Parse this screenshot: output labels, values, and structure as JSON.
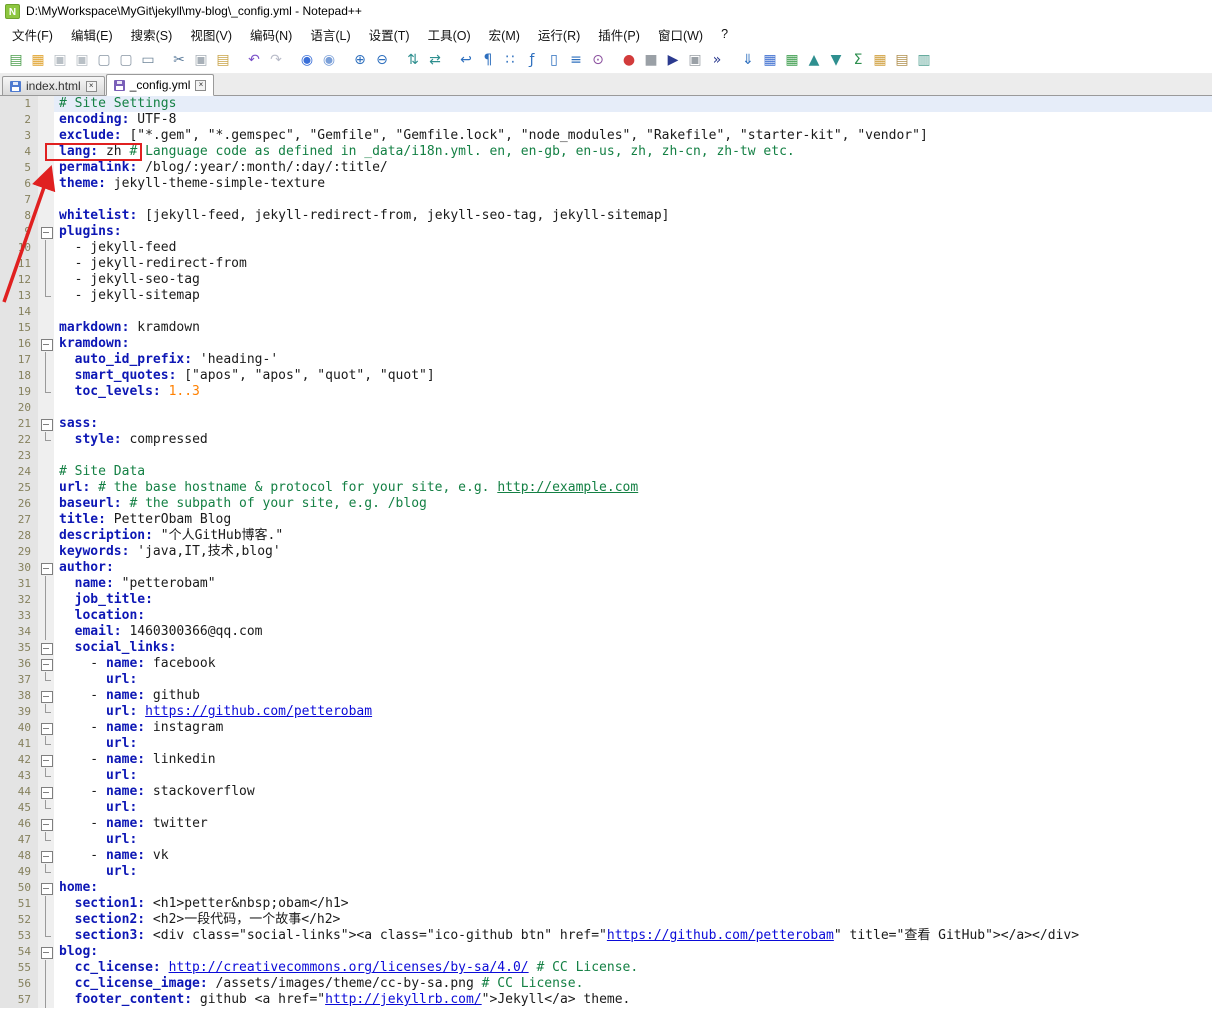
{
  "window": {
    "title": "D:\\MyWorkspace\\MyGit\\jekyll\\my-blog\\_config.yml - Notepad++"
  },
  "menu": {
    "items": [
      {
        "id": "file",
        "label": "文件(F)"
      },
      {
        "id": "edit",
        "label": "编辑(E)"
      },
      {
        "id": "search",
        "label": "搜索(S)"
      },
      {
        "id": "view",
        "label": "视图(V)"
      },
      {
        "id": "encoding",
        "label": "编码(N)"
      },
      {
        "id": "language",
        "label": "语言(L)"
      },
      {
        "id": "settings",
        "label": "设置(T)"
      },
      {
        "id": "tools",
        "label": "工具(O)"
      },
      {
        "id": "macro",
        "label": "宏(M)"
      },
      {
        "id": "run",
        "label": "运行(R)"
      },
      {
        "id": "plugins",
        "label": "插件(P)"
      },
      {
        "id": "window",
        "label": "窗口(W)"
      },
      {
        "id": "help",
        "label": "?"
      }
    ]
  },
  "toolbar": {
    "items": [
      {
        "n": "new-file",
        "g": "▤",
        "c": "#4d9e4d"
      },
      {
        "n": "open-file",
        "g": "▦",
        "c": "#e0a32e"
      },
      {
        "n": "save-file",
        "g": "▣",
        "c": "#b9c0c6"
      },
      {
        "n": "save-all",
        "g": "▣",
        "c": "#b9c0c6"
      },
      {
        "n": "close-file",
        "g": "▢",
        "c": "#8a97a5"
      },
      {
        "n": "close-all",
        "g": "▢",
        "c": "#8a97a5"
      },
      {
        "n": "print",
        "g": "▭",
        "c": "#6f8699"
      },
      {
        "n": "cut",
        "g": "✂",
        "c": "#5a7a9a",
        "gap": true
      },
      {
        "n": "copy",
        "g": "▣",
        "c": "#a8b0b8"
      },
      {
        "n": "paste",
        "g": "▤",
        "c": "#caa54a"
      },
      {
        "n": "undo",
        "g": "↶",
        "c": "#7b52c9",
        "gap": true
      },
      {
        "n": "redo",
        "g": "↷",
        "c": "#b9bcc9"
      },
      {
        "n": "find",
        "g": "◉",
        "c": "#3a6fd8",
        "gap": true
      },
      {
        "n": "replace",
        "g": "◉",
        "c": "#7a9fd8"
      },
      {
        "n": "zoom-in",
        "g": "⊕",
        "c": "#2e6fbe",
        "gap": true
      },
      {
        "n": "zoom-out",
        "g": "⊖",
        "c": "#2e6fbe"
      },
      {
        "n": "sync-vertical",
        "g": "⇅",
        "c": "#2e8f8f",
        "gap": true
      },
      {
        "n": "sync-horizontal",
        "g": "⇄",
        "c": "#2e8f8f"
      },
      {
        "n": "word-wrap",
        "g": "↩",
        "c": "#2e6fbe",
        "gap": true
      },
      {
        "n": "show-all-characters",
        "g": "¶",
        "c": "#2e6fbe"
      },
      {
        "n": "indent-guide",
        "g": "∷",
        "c": "#2e6fbe"
      },
      {
        "n": "function-list",
        "g": "ƒ",
        "c": "#2e6fbe"
      },
      {
        "n": "document-map",
        "g": "▯",
        "c": "#2e6fbe"
      },
      {
        "n": "document-list",
        "g": "≡",
        "c": "#2e6fbe"
      },
      {
        "n": "monitoring",
        "g": "⊙",
        "c": "#8a4f9e"
      },
      {
        "n": "record-macro",
        "g": "●",
        "c": "#d23b3b",
        "gap": true
      },
      {
        "n": "stop-recording",
        "g": "■",
        "c": "#9aa0a6"
      },
      {
        "n": "playback-macro",
        "g": "▶",
        "c": "#2b3a8f"
      },
      {
        "n": "save-macro",
        "g": "▣",
        "c": "#9aa0a6"
      },
      {
        "n": "run-macro-multiple",
        "g": "»",
        "c": "#2b3a8f"
      },
      {
        "n": "plugin-import",
        "g": "⇓",
        "c": "#2e6fbe",
        "gap": true
      },
      {
        "n": "plugin-grid-blue",
        "g": "▦",
        "c": "#3f6fd0"
      },
      {
        "n": "plugin-grid-green",
        "g": "▦",
        "c": "#3f9e4f"
      },
      {
        "n": "sort-ascending",
        "g": "▲",
        "c": "#2e8f8f"
      },
      {
        "n": "sort-descending",
        "g": "▼",
        "c": "#2e8f8f"
      },
      {
        "n": "plugin-sum",
        "g": "Σ",
        "c": "#2e8f4f"
      },
      {
        "n": "plugin-grid-yellow",
        "g": "▦",
        "c": "#d0a03f"
      },
      {
        "n": "plugin-clipboard",
        "g": "▤",
        "c": "#b08f4f"
      },
      {
        "n": "plugin-notes",
        "g": "▥",
        "c": "#4f9e8f"
      }
    ]
  },
  "tabbar": {
    "close_glyph": "×",
    "tabs": [
      {
        "id": "index-html",
        "label": "index.html",
        "active": false,
        "icon_color": "#4f7bd0"
      },
      {
        "id": "config-yml",
        "label": "_config.yml",
        "active": true,
        "icon_color": "#7a5fb8"
      }
    ]
  },
  "editor": {
    "lines": [
      {
        "hl": true,
        "seg": [
          [
            "# Site Settings",
            "com"
          ]
        ]
      },
      {
        "seg": [
          [
            "encoding:",
            "key"
          ],
          [
            " UTF-8",
            "val"
          ]
        ]
      },
      {
        "seg": [
          [
            "exclude:",
            "key"
          ],
          [
            " [\"*.gem\", \"*.gemspec\", \"Gemfile\", \"Gemfile.lock\", \"node_modules\", \"Rakefile\", \"starter-kit\", \"vendor\"]",
            "val"
          ]
        ]
      },
      {
        "seg": [
          [
            "lang:",
            "key"
          ],
          [
            " zh ",
            "val"
          ],
          [
            "# Language code as defined in _data/i18n.yml. en, en-gb, en-us, zh, zh-cn, zh-tw etc.",
            "com"
          ]
        ]
      },
      {
        "seg": [
          [
            "permalink:",
            "key"
          ],
          [
            " /blog/:year/:month/:day/:title/",
            "val"
          ]
        ]
      },
      {
        "seg": [
          [
            "theme:",
            "key"
          ],
          [
            " jekyll-theme-simple-texture",
            "val"
          ]
        ]
      },
      {
        "seg": []
      },
      {
        "seg": [
          [
            "whitelist:",
            "key"
          ],
          [
            " [jekyll-feed, jekyll-redirect-from, jekyll-seo-tag, jekyll-sitemap]",
            "val"
          ]
        ]
      },
      {
        "fold": "start",
        "seg": [
          [
            "plugins:",
            "key"
          ]
        ]
      },
      {
        "fold": "mid",
        "seg": [
          [
            "  - jekyll-feed",
            "val"
          ]
        ]
      },
      {
        "fold": "mid",
        "seg": [
          [
            "  - jekyll-redirect-from",
            "val"
          ]
        ]
      },
      {
        "fold": "mid",
        "seg": [
          [
            "  - jekyll-seo-tag",
            "val"
          ]
        ]
      },
      {
        "fold": "end",
        "seg": [
          [
            "  - jekyll-sitemap",
            "val"
          ]
        ]
      },
      {
        "seg": []
      },
      {
        "seg": [
          [
            "markdown:",
            "key"
          ],
          [
            " kramdown",
            "val"
          ]
        ]
      },
      {
        "fold": "start",
        "seg": [
          [
            "kramdown:",
            "key"
          ]
        ]
      },
      {
        "fold": "mid",
        "seg": [
          [
            "  ",
            "val"
          ],
          [
            "auto_id_prefix:",
            "key"
          ],
          [
            " 'heading-'",
            "val"
          ]
        ]
      },
      {
        "fold": "mid",
        "seg": [
          [
            "  ",
            "val"
          ],
          [
            "smart_quotes:",
            "key"
          ],
          [
            " [\"apos\", \"apos\", \"quot\", \"quot\"]",
            "val"
          ]
        ]
      },
      {
        "fold": "end",
        "seg": [
          [
            "  ",
            "val"
          ],
          [
            "toc_levels:",
            "key"
          ],
          [
            " ",
            "val"
          ],
          [
            "1..3",
            "num"
          ]
        ]
      },
      {
        "seg": []
      },
      {
        "fold": "start",
        "seg": [
          [
            "sass:",
            "key"
          ]
        ]
      },
      {
        "fold": "end",
        "seg": [
          [
            "  ",
            "val"
          ],
          [
            "style:",
            "key"
          ],
          [
            " compressed",
            "val"
          ]
        ]
      },
      {
        "seg": []
      },
      {
        "seg": [
          [
            "# Site Data",
            "com"
          ]
        ]
      },
      {
        "seg": [
          [
            "url:",
            "key"
          ],
          [
            " ",
            "val"
          ],
          [
            "# the base hostname & protocol for your site, e.g. ",
            "com"
          ],
          [
            "http://example.com",
            "lnkc"
          ]
        ]
      },
      {
        "seg": [
          [
            "baseurl:",
            "key"
          ],
          [
            " ",
            "val"
          ],
          [
            "# the subpath of your site, e.g. /blog",
            "com"
          ]
        ]
      },
      {
        "seg": [
          [
            "title:",
            "key"
          ],
          [
            " PetterObam Blog",
            "val"
          ]
        ]
      },
      {
        "seg": [
          [
            "description:",
            "key"
          ],
          [
            " \"个人GitHub博客.\"",
            "val"
          ]
        ]
      },
      {
        "seg": [
          [
            "keywords:",
            "key"
          ],
          [
            " 'java,IT,技术,blog'",
            "val"
          ]
        ]
      },
      {
        "fold": "start",
        "seg": [
          [
            "author:",
            "key"
          ]
        ]
      },
      {
        "fold": "mid",
        "seg": [
          [
            "  ",
            "val"
          ],
          [
            "name:",
            "key"
          ],
          [
            " \"petterobam\"",
            "val"
          ]
        ]
      },
      {
        "fold": "mid",
        "seg": [
          [
            "  ",
            "val"
          ],
          [
            "job_title:",
            "key"
          ]
        ]
      },
      {
        "fold": "mid",
        "seg": [
          [
            "  ",
            "val"
          ],
          [
            "location:",
            "key"
          ]
        ]
      },
      {
        "fold": "mid",
        "seg": [
          [
            "  ",
            "val"
          ],
          [
            "email:",
            "key"
          ],
          [
            " 1460300366@qq.com",
            "val"
          ]
        ]
      },
      {
        "fold": "start",
        "seg": [
          [
            "  ",
            "val"
          ],
          [
            "social_links:",
            "key"
          ]
        ]
      },
      {
        "fold": "start",
        "seg": [
          [
            "    - ",
            "val"
          ],
          [
            "name:",
            "key"
          ],
          [
            " facebook",
            "val"
          ]
        ]
      },
      {
        "fold": "end",
        "seg": [
          [
            "      ",
            "val"
          ],
          [
            "url:",
            "key"
          ]
        ]
      },
      {
        "fold": "start",
        "seg": [
          [
            "    - ",
            "val"
          ],
          [
            "name:",
            "key"
          ],
          [
            " github",
            "val"
          ]
        ]
      },
      {
        "fold": "end",
        "seg": [
          [
            "      ",
            "val"
          ],
          [
            "url:",
            "key"
          ],
          [
            " ",
            "val"
          ],
          [
            "https://github.com/petterobam",
            "lnk"
          ]
        ]
      },
      {
        "fold": "start",
        "seg": [
          [
            "    - ",
            "val"
          ],
          [
            "name:",
            "key"
          ],
          [
            " instagram",
            "val"
          ]
        ]
      },
      {
        "fold": "end",
        "seg": [
          [
            "      ",
            "val"
          ],
          [
            "url:",
            "key"
          ]
        ]
      },
      {
        "fold": "start",
        "seg": [
          [
            "    - ",
            "val"
          ],
          [
            "name:",
            "key"
          ],
          [
            " linkedin",
            "val"
          ]
        ]
      },
      {
        "fold": "end",
        "seg": [
          [
            "      ",
            "val"
          ],
          [
            "url:",
            "key"
          ]
        ]
      },
      {
        "fold": "start",
        "seg": [
          [
            "    - ",
            "val"
          ],
          [
            "name:",
            "key"
          ],
          [
            " stackoverflow",
            "val"
          ]
        ]
      },
      {
        "fold": "end",
        "seg": [
          [
            "      ",
            "val"
          ],
          [
            "url:",
            "key"
          ]
        ]
      },
      {
        "fold": "start",
        "seg": [
          [
            "    - ",
            "val"
          ],
          [
            "name:",
            "key"
          ],
          [
            " twitter",
            "val"
          ]
        ]
      },
      {
        "fold": "end",
        "seg": [
          [
            "      ",
            "val"
          ],
          [
            "url:",
            "key"
          ]
        ]
      },
      {
        "fold": "start",
        "seg": [
          [
            "    - ",
            "val"
          ],
          [
            "name:",
            "key"
          ],
          [
            " vk",
            "val"
          ]
        ]
      },
      {
        "fold": "end",
        "seg": [
          [
            "      ",
            "val"
          ],
          [
            "url:",
            "key"
          ]
        ]
      },
      {
        "fold": "start",
        "seg": [
          [
            "home:",
            "key"
          ]
        ]
      },
      {
        "fold": "mid",
        "seg": [
          [
            "  ",
            "val"
          ],
          [
            "section1:",
            "key"
          ],
          [
            " <h1>petter&nbsp;obam</h1>",
            "val"
          ]
        ]
      },
      {
        "fold": "mid",
        "seg": [
          [
            "  ",
            "val"
          ],
          [
            "section2:",
            "key"
          ],
          [
            " <h2>一段代码，一个故事</h2>",
            "val"
          ]
        ]
      },
      {
        "fold": "end",
        "seg": [
          [
            "  ",
            "val"
          ],
          [
            "section3:",
            "key"
          ],
          [
            " <div class=\"social-links\"><a class=\"ico-github btn\" href=\"",
            "val"
          ],
          [
            "https://github.com/petterobam",
            "lnk"
          ],
          [
            "\" title=\"查看 GitHub\"></a></div>",
            "val"
          ]
        ]
      },
      {
        "fold": "start",
        "seg": [
          [
            "blog:",
            "key"
          ]
        ]
      },
      {
        "fold": "mid",
        "seg": [
          [
            "  ",
            "val"
          ],
          [
            "cc_license:",
            "key"
          ],
          [
            " ",
            "val"
          ],
          [
            "http://creativecommons.org/licenses/by-sa/4.0/",
            "lnk"
          ],
          [
            " ",
            "val"
          ],
          [
            "# CC License.",
            "com"
          ]
        ]
      },
      {
        "fold": "mid",
        "seg": [
          [
            "  ",
            "val"
          ],
          [
            "cc_license_image:",
            "key"
          ],
          [
            " /assets/images/theme/cc-by-sa.png ",
            "val"
          ],
          [
            "# CC License.",
            "com"
          ]
        ]
      },
      {
        "fold": "mid",
        "seg": [
          [
            "  ",
            "val"
          ],
          [
            "footer_content:",
            "key"
          ],
          [
            " github <a href=\"",
            "val"
          ],
          [
            "http://jekyllrb.com/",
            "lnk"
          ],
          [
            "\">Jekyll</a> theme.",
            "val"
          ]
        ]
      }
    ]
  },
  "annotation": {
    "color": "#e02020",
    "target_text": "lang: zh"
  },
  "colors": {
    "key": "#0d17b5",
    "comment": "#148044",
    "number": "#ff8000",
    "link": "#0b0bd8",
    "current_line_bg": "#e6edf9",
    "gutter_bg": "#e4e4e4"
  }
}
